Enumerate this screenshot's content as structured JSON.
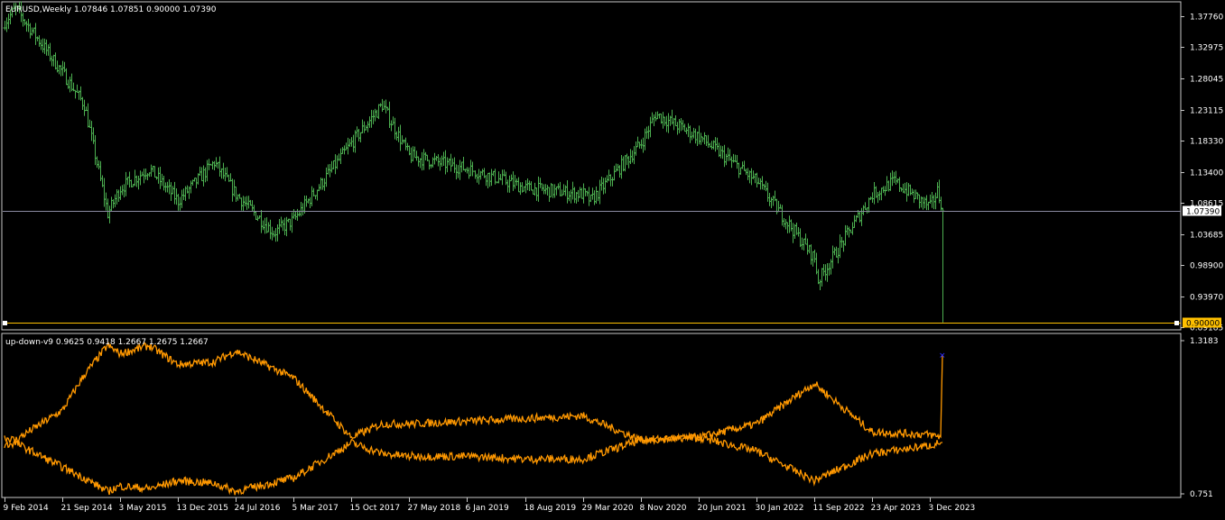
{
  "main_title": "EURUSD,Weekly  1.07846 1.07851 0.90000 1.07390",
  "indicator_title": "up-down-v9 0.9625 0.9418 1.2667 1.2675 1.2667",
  "colors": {
    "background": "#000000",
    "frame": "#c8c8c8",
    "bars": "#4caf50",
    "indicator": "#ff9800",
    "marker": "#2a2aff",
    "bid_line": "#8a8aa0",
    "level_line": "#ffc000",
    "label_dark": "#000000"
  },
  "price_axis": {
    "ticks": [
      "1.37760",
      "1.32975",
      "1.28045",
      "1.23115",
      "1.18330",
      "1.13400",
      "1.08615",
      "1.03685",
      "0.98900",
      "0.93970",
      "0.89185"
    ],
    "current_price_label": "1.07390",
    "level_label": "0.90000"
  },
  "indicator_axis": {
    "ticks": [
      "1.3183",
      "0.751"
    ]
  },
  "time_axis": {
    "labels": [
      "9 Feb 2014",
      "21 Sep 2014",
      "3 May 2015",
      "13 Dec 2015",
      "24 Jul 2016",
      "5 Mar 2017",
      "15 Oct 2017",
      "27 May 2018",
      "6 Jan 2019",
      "18 Aug 2019",
      "29 Mar 2020",
      "8 Nov 2020",
      "20 Jun 2021",
      "30 Jan 2022",
      "11 Sep 2022",
      "23 Apr 2023",
      "3 Dec 2023"
    ]
  },
  "chart_data": [
    {
      "type": "bar",
      "symbol": "EURUSD",
      "timeframe": "Weekly",
      "last_bar": {
        "open": 1.07846,
        "high": 1.07851,
        "low": 0.9,
        "close": 1.0739
      },
      "ylim": [
        0.8912,
        1.398
      ],
      "level": 0.9,
      "current_price": 1.0739,
      "anchors": [
        {
          "date": "9 Feb 2014",
          "price": 1.37
        },
        {
          "date": "23 Mar 2014",
          "price": 1.39
        },
        {
          "date": "21 Sep 2014",
          "price": 1.29
        },
        {
          "date": "14 Dec 2014",
          "price": 1.24
        },
        {
          "date": "15 Mar 2015",
          "price": 1.07
        },
        {
          "date": "3 May 2015",
          "price": 1.11
        },
        {
          "date": "23 Aug 2015",
          "price": 1.14
        },
        {
          "date": "13 Dec 2015",
          "price": 1.09
        },
        {
          "date": "1 May 2016",
          "price": 1.15
        },
        {
          "date": "24 Jul 2016",
          "price": 1.1
        },
        {
          "date": "18 Dec 2016",
          "price": 1.04
        },
        {
          "date": "5 Mar 2017",
          "price": 1.06
        },
        {
          "date": "15 Oct 2017",
          "price": 1.18
        },
        {
          "date": "11 Feb 2018",
          "price": 1.24
        },
        {
          "date": "27 May 2018",
          "price": 1.16
        },
        {
          "date": "6 Jan 2019",
          "price": 1.14
        },
        {
          "date": "18 Aug 2019",
          "price": 1.11
        },
        {
          "date": "29 Mar 2020",
          "price": 1.1
        },
        {
          "date": "26 Apr 2020",
          "price": 1.09
        },
        {
          "date": "8 Nov 2020",
          "price": 1.18
        },
        {
          "date": "3 Jan 2021",
          "price": 1.225
        },
        {
          "date": "20 Jun 2021",
          "price": 1.19
        },
        {
          "date": "30 Jan 2022",
          "price": 1.12
        },
        {
          "date": "11 Sep 2022",
          "price": 1.0
        },
        {
          "date": "25 Sep 2022",
          "price": 0.965
        },
        {
          "date": "23 Apr 2023",
          "price": 1.1
        },
        {
          "date": "16 Jul 2023",
          "price": 1.12
        },
        {
          "date": "3 Dec 2023",
          "price": 1.08
        },
        {
          "date": "31 Dec 2023",
          "price": 1.105
        },
        {
          "date": "21 Jan 2024",
          "price": 1.0785
        }
      ]
    },
    {
      "type": "line",
      "name": "up-down-v9",
      "ylim": [
        0.751,
        1.3183
      ],
      "values": [
        0.9625,
        0.9418,
        1.2667,
        1.2675,
        1.2667
      ],
      "series": [
        {
          "anchors": [
            {
              "date": "9 Feb 2014",
              "value": 0.96
            },
            {
              "date": "23 Mar 2014",
              "value": 0.95
            },
            {
              "date": "21 Sep 2014",
              "value": 1.06
            },
            {
              "date": "14 Dec 2014",
              "value": 1.19
            },
            {
              "date": "15 Mar 2015",
              "value": 1.3
            },
            {
              "date": "3 May 2015",
              "value": 1.27
            },
            {
              "date": "23 Aug 2015",
              "value": 1.3
            },
            {
              "date": "13 Dec 2015",
              "value": 1.23
            },
            {
              "date": "1 May 2016",
              "value": 1.24
            },
            {
              "date": "24 Jul 2016",
              "value": 1.28
            },
            {
              "date": "5 Mar 2017",
              "value": 1.18
            },
            {
              "date": "15 Oct 2017",
              "value": 0.96
            },
            {
              "date": "11 Feb 2018",
              "value": 1.01
            },
            {
              "date": "27 May 2018",
              "value": 1.01
            },
            {
              "date": "6 Jan 2019",
              "value": 1.02
            },
            {
              "date": "18 Aug 2019",
              "value": 1.03
            },
            {
              "date": "29 Mar 2020",
              "value": 1.04
            },
            {
              "date": "8 Nov 2020",
              "value": 0.95
            },
            {
              "date": "20 Jun 2021",
              "value": 0.96
            },
            {
              "date": "30 Jan 2022",
              "value": 1.01
            },
            {
              "date": "11 Sep 2022",
              "value": 1.16
            },
            {
              "date": "23 Apr 2023",
              "value": 0.98
            },
            {
              "date": "3 Dec 2023",
              "value": 0.97
            },
            {
              "date": "14 Jan 2024",
              "value": 0.9625
            },
            {
              "date": "21 Jan 2024",
              "value": 1.2667
            }
          ]
        },
        {
          "anchors": [
            {
              "date": "9 Feb 2014",
              "value": 0.93
            },
            {
              "date": "23 Mar 2014",
              "value": 0.94
            },
            {
              "date": "21 Sep 2014",
              "value": 0.85
            },
            {
              "date": "14 Dec 2014",
              "value": 0.81
            },
            {
              "date": "15 Mar 2015",
              "value": 0.76
            },
            {
              "date": "3 May 2015",
              "value": 0.78
            },
            {
              "date": "23 Aug 2015",
              "value": 0.77
            },
            {
              "date": "13 Dec 2015",
              "value": 0.8
            },
            {
              "date": "1 May 2016",
              "value": 0.79
            },
            {
              "date": "24 Jul 2016",
              "value": 0.76
            },
            {
              "date": "5 Mar 2017",
              "value": 0.81
            },
            {
              "date": "15 Oct 2017",
              "value": 0.94
            },
            {
              "date": "11 Feb 2018",
              "value": 0.9
            },
            {
              "date": "27 May 2018",
              "value": 0.89
            },
            {
              "date": "6 Jan 2019",
              "value": 0.89
            },
            {
              "date": "18 Aug 2019",
              "value": 0.88
            },
            {
              "date": "29 Mar 2020",
              "value": 0.88
            },
            {
              "date": "8 Nov 2020",
              "value": 0.95
            },
            {
              "date": "20 Jun 2021",
              "value": 0.96
            },
            {
              "date": "30 Jan 2022",
              "value": 0.91
            },
            {
              "date": "11 Sep 2022",
              "value": 0.8
            },
            {
              "date": "23 Apr 2023",
              "value": 0.9
            },
            {
              "date": "3 Dec 2023",
              "value": 0.93
            },
            {
              "date": "21 Jan 2024",
              "value": 0.9418
            }
          ]
        }
      ]
    }
  ]
}
